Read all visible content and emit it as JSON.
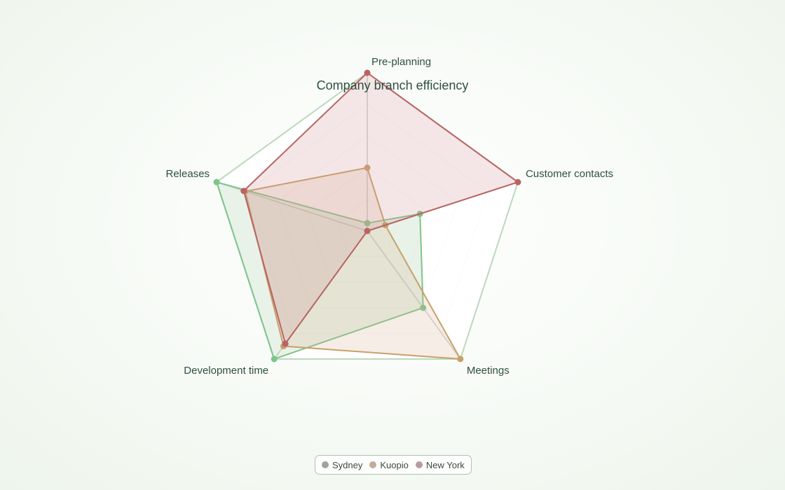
{
  "chart_data": {
    "type": "radar",
    "title": "Company branch efficiency",
    "axes": [
      "Pre-planning",
      "Customer contacts",
      "Meetings",
      "Development time",
      "Releases"
    ],
    "rmax": 100,
    "ticks": [
      20,
      40,
      60,
      80,
      100
    ],
    "grid": true,
    "legend_position": "bottom-center",
    "series": [
      {
        "name": "Sydney",
        "values": [
          5,
          35,
          60,
          100,
          100
        ],
        "color": "#7fc48a",
        "swatch": "#9aa59c",
        "fill": "rgba(150,195,150,0.22)"
      },
      {
        "name": "Kuopio",
        "values": [
          40,
          12,
          100,
          90,
          81
        ],
        "color": "#c8a06a",
        "swatch": "#c4ab98",
        "fill": "rgba(215,175,140,0.22)"
      },
      {
        "name": "New York",
        "values": [
          100,
          100,
          0,
          88,
          82
        ],
        "color": "#b96464",
        "swatch": "#b79c9f",
        "fill": "rgba(205,140,145,0.22)"
      }
    ]
  }
}
